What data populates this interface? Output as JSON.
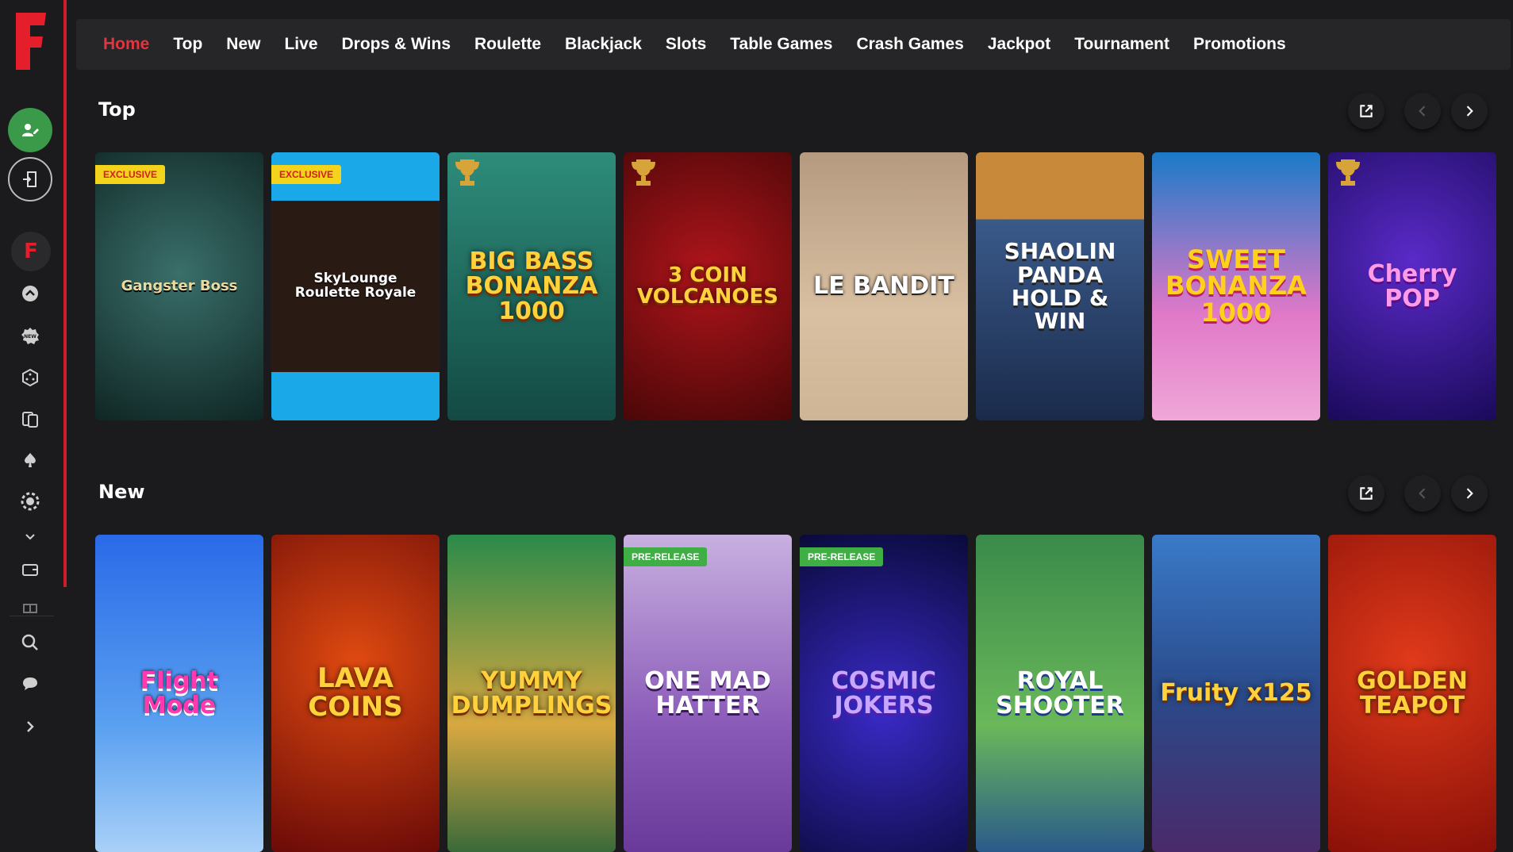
{
  "sidebar": {
    "logo_letter": "F",
    "small_logo_letter": "F"
  },
  "nav": {
    "items": [
      {
        "label": "Home",
        "active": true
      },
      {
        "label": "Top",
        "active": false
      },
      {
        "label": "New",
        "active": false
      },
      {
        "label": "Live",
        "active": false
      },
      {
        "label": "Drops & Wins",
        "active": false
      },
      {
        "label": "Roulette",
        "active": false
      },
      {
        "label": "Blackjack",
        "active": false
      },
      {
        "label": "Slots",
        "active": false
      },
      {
        "label": "Table Games",
        "active": false
      },
      {
        "label": "Crash Games",
        "active": false
      },
      {
        "label": "Jackpot",
        "active": false
      },
      {
        "label": "Tournament",
        "active": false
      },
      {
        "label": "Promotions",
        "active": false
      }
    ]
  },
  "sections": {
    "top": {
      "title": "Top",
      "games": [
        {
          "name": "Gangster Boss",
          "badge": "EXCLUSIVE",
          "trophy": false
        },
        {
          "name": "SkyLounge Roulette Royale",
          "badge": "EXCLUSIVE",
          "trophy": false
        },
        {
          "name": "BIG BASS BONANZA 1000",
          "badge": "",
          "trophy": true
        },
        {
          "name": "3 COIN VOLCANOES",
          "badge": "",
          "trophy": true
        },
        {
          "name": "LE BANDIT",
          "badge": "",
          "trophy": false
        },
        {
          "name": "SHAOLIN PANDA HOLD & WIN",
          "badge": "",
          "trophy": false
        },
        {
          "name": "SWEET BONANZA 1000",
          "badge": "",
          "trophy": false
        },
        {
          "name": "Cherry POP",
          "badge": "",
          "trophy": true
        }
      ]
    },
    "new": {
      "title": "New",
      "games": [
        {
          "name": "Flight Mode",
          "badge": ""
        },
        {
          "name": "LAVA COINS",
          "badge": ""
        },
        {
          "name": "YUMMY DUMPLINGS",
          "badge": ""
        },
        {
          "name": "ONE MAD HATTER",
          "badge": "PRE-RELEASE"
        },
        {
          "name": "COSMIC JOKERS",
          "badge": "PRE-RELEASE"
        },
        {
          "name": "ROYAL SHOOTER",
          "badge": ""
        },
        {
          "name": "Fruity x125",
          "badge": ""
        },
        {
          "name": "GOLDEN TEAPOT",
          "badge": ""
        }
      ]
    }
  },
  "colors": {
    "accent_red": "#e4343f",
    "register_green": "#3a9a4a",
    "exclusive_yellow": "#f4d31c",
    "prerelease_green": "#3fae45"
  }
}
